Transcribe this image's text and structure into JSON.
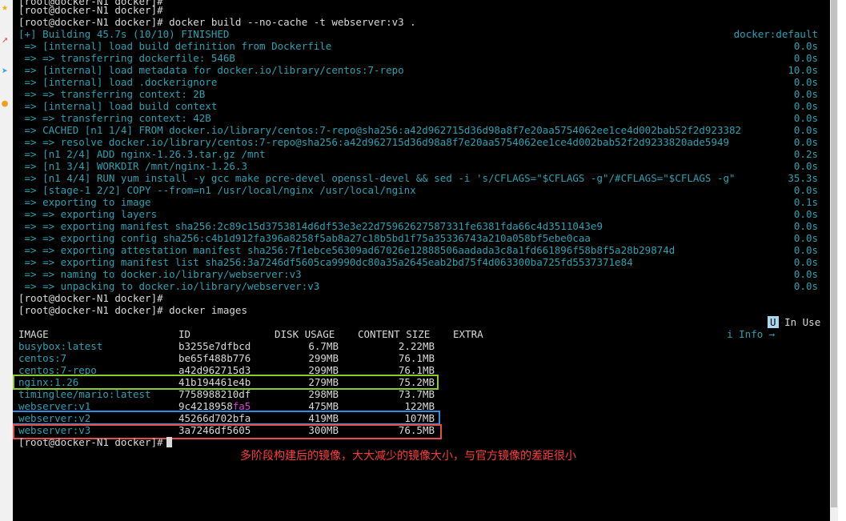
{
  "terminal": {
    "top_partial": "[root@docker-N1 docker]#",
    "prompt1": "[root@docker-N1 docker]#",
    "cmd1": "[root@docker-N1 docker]# docker build --no-cache -t webserver:v3 .",
    "build_status": "[+] Building 45.7s (10/10) FINISHED",
    "build_context": "docker:default",
    "steps": [
      {
        "text": " => [internal] load build definition from Dockerfile",
        "time": "0.0s"
      },
      {
        "text": " => => transferring dockerfile: 546B",
        "time": "0.0s"
      },
      {
        "text": " => [internal] load metadata for docker.io/library/centos:7-repo",
        "time": "10.0s"
      },
      {
        "text": " => [internal] load .dockerignore",
        "time": "0.0s"
      },
      {
        "text": " => => transferring context: 2B",
        "time": "0.0s"
      },
      {
        "text": " => [internal] load build context",
        "time": "0.0s"
      },
      {
        "text": " => => transferring context: 42B",
        "time": "0.0s"
      },
      {
        "text": " => CACHED [n1 1/4] FROM docker.io/library/centos:7-repo@sha256:a42d962715d36d98a8f7e20aa5754062ee1ce4d002bab52f2d923382",
        "time": "0.0s"
      },
      {
        "text": " => => resolve docker.io/library/centos:7-repo@sha256:a42d962715d36d98a8f7e20aa5754062ee1ce4d002bab52f2d9233820ade5949",
        "time": "0.0s"
      },
      {
        "text": " => [n1 2/4] ADD nginx-1.26.3.tar.gz /mnt",
        "time": "0.2s"
      },
      {
        "text": " => [n1 3/4] WORKDIR /mnt/nginx-1.26.3",
        "time": "0.0s"
      },
      {
        "text": " => [n1 4/4] RUN yum install -y gcc make pcre-devel openssl-devel && sed -i 's/CFLAGS=\"$CFLAGS -g\"/#CFLAGS=\"$CFLAGS -g\"",
        "time": "35.3s"
      },
      {
        "text": " => [stage-1 2/2] COPY --from=n1 /usr/local/nginx /usr/local/nginx",
        "time": "0.0s"
      },
      {
        "text": " => exporting to image",
        "time": "0.1s"
      },
      {
        "text": " => => exporting layers",
        "time": "0.0s"
      },
      {
        "text": " => => exporting manifest sha256:2c89c15d3753814d6df53e3e22d75962627587331fe6381fda66c4d3511043e9",
        "time": "0.0s"
      },
      {
        "text": " => => exporting config sha256:c4b1d912fa396a8258f5ab8a27c18b5bd1f75a35336743a210a058bf5ebe0caa",
        "time": "0.0s"
      },
      {
        "text": " => => exporting attestation manifest sha256:7f1ebce56309ad67026e12888506aadada3c8a1fd661896f58b8f5a28b29874d",
        "time": "0.0s"
      },
      {
        "text": " => => exporting manifest list sha256:3a7246df5605ca9990dc80a35a2645eab2bd75f4d063300ba725fd5537371e84",
        "time": "0.0s"
      },
      {
        "text": " => => naming to docker.io/library/webserver:v3",
        "time": "0.0s"
      },
      {
        "text": " => => unpacking to docker.io/library/webserver:v3",
        "time": "0.0s"
      }
    ],
    "prompt2": "[root@docker-N1 docker]#",
    "cmd2": "[root@docker-N1 docker]# docker images",
    "legend_info": "i Info →",
    "legend_u": "U",
    "legend_inuse": "In Use",
    "columns": [
      "IMAGE",
      "ID",
      "DISK USAGE",
      "CONTENT SIZE",
      "EXTRA"
    ],
    "rows": [
      {
        "image": "busybox:latest",
        "id": "b3255e7dfbcd",
        "id_extra": "",
        "disk": "6.7MB",
        "content": "2.22MB"
      },
      {
        "image": "centos:7",
        "id": "be65f488b776",
        "id_extra": "",
        "disk": "299MB",
        "content": "76.1MB"
      },
      {
        "image": "centos:7-repo",
        "id": "a42d962715d3",
        "id_extra": "",
        "disk": "299MB",
        "content": "76.1MB"
      },
      {
        "image": "nginx:1.26",
        "id": "41b194461e4b",
        "id_extra": "",
        "disk": "279MB",
        "content": "75.2MB"
      },
      {
        "image": "timinglee/mario:latest",
        "id": "7758988210df",
        "id_extra": "",
        "disk": "298MB",
        "content": "73.7MB"
      },
      {
        "image": "webserver:v1",
        "id": "9c4218958",
        "id_extra": "fa5",
        "disk": "475MB",
        "content": "122MB"
      },
      {
        "image": "webserver:v2",
        "id": "45266d702bfa",
        "id_extra": "",
        "disk": "419MB",
        "content": "107MB"
      },
      {
        "image": "webserver:v3",
        "id": "3a7246df5605",
        "id_extra": "",
        "disk": "300MB",
        "content": "76.5MB"
      }
    ],
    "final_prompt": "[root@docker-N1 docker]#"
  },
  "annotation": "多阶段构建后的镜像，大大减少的镜像大小，与官方镜像的差距很小",
  "colors": {
    "background": "#000000",
    "text": "#d8d8d8",
    "cyan": "#2aa1b3",
    "box_green": "#8ccc2a",
    "box_blue": "#2c8fe0",
    "box_red": "#e0504a",
    "annotation_red": "#ff3b3b"
  },
  "strip_icons": [
    "star-icon",
    "arrow-icon",
    "send-icon",
    "smiley-icon"
  ]
}
